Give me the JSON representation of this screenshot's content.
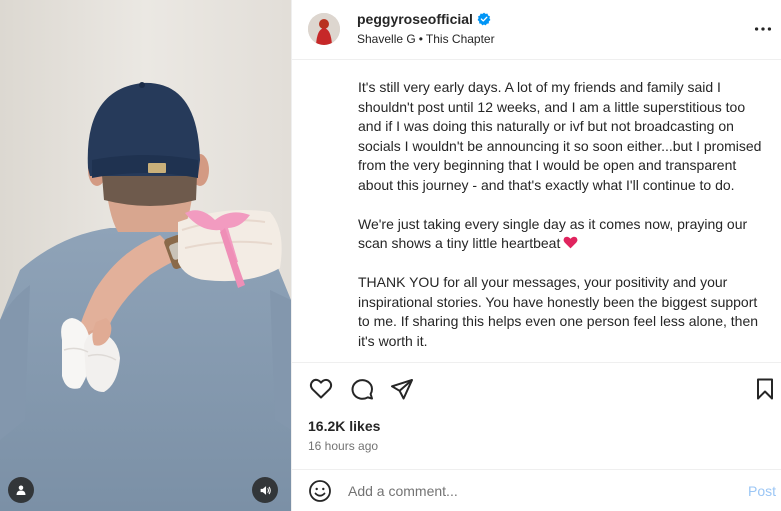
{
  "media": {
    "tag_icon": "person-icon",
    "audio_icon": "speaker-icon"
  },
  "header": {
    "username": "peggyroseofficial",
    "verified_icon": "verified-badge-icon",
    "audio_artist": "Shavelle G",
    "separator": "•",
    "audio_track": "This Chapter",
    "more_icon": "more-options-icon"
  },
  "caption": {
    "paragraphs": [
      "It's still very early days. A lot of my friends and family said I shouldn't post until 12 weeks, and I am a little superstitious too and if I was doing this naturally or ivf but not broadcasting on socials I wouldn't be announcing it so soon either...but I promised from the very beginning that I would be open and transparent about this journey - and that's exactly what I'll continue to do.",
      "We're just taking every single day as it comes now, praying our scan shows a tiny little heartbeat",
      "THANK YOU for all your messages, your positivity and your inspirational stories. You have honestly been the biggest support to me. If sharing this helps even one person feel less alone, then it's worth it."
    ],
    "heart_icon": "red-heart-emoji-icon"
  },
  "actions": {
    "like_icon": "heart-outline-icon",
    "comment_icon": "comment-bubble-icon",
    "share_icon": "paper-plane-icon",
    "save_icon": "bookmark-icon"
  },
  "stats": {
    "likes": "16.2K likes",
    "time": "16 hours ago"
  },
  "comment": {
    "emoji_icon": "smiley-icon",
    "placeholder": "Add a comment...",
    "post_label": "Post"
  },
  "colors": {
    "text": "#262626",
    "muted": "#737373",
    "verified": "#0095f6",
    "post_disabled": "#9bc6f5",
    "divider": "#efefef",
    "heart": "#e0245e"
  }
}
